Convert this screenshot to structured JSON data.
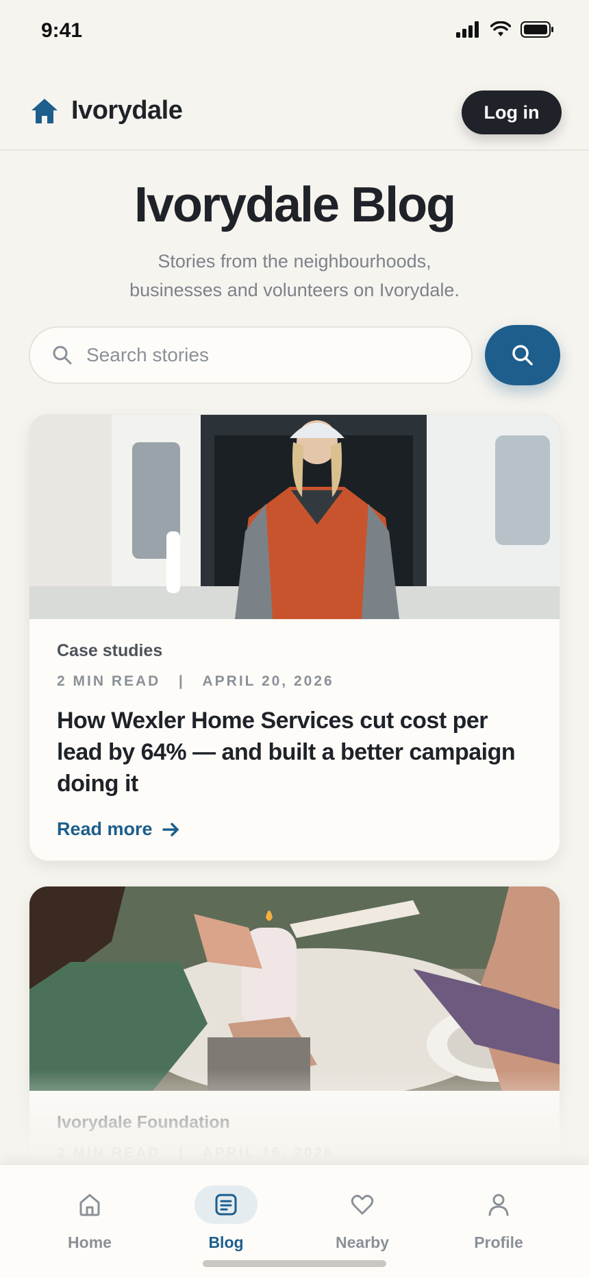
{
  "status_bar": {
    "time": "9:41"
  },
  "header": {
    "brand": "Ivorydale",
    "login_label": "Log in"
  },
  "hero": {
    "title": "Ivorydale Blog",
    "subtitle_line1": "Stories from the neighbourhoods,",
    "subtitle_line2": "businesses and volunteers on Ivorydale."
  },
  "search": {
    "placeholder": "Search stories",
    "value": ""
  },
  "posts": [
    {
      "category": "Case studies",
      "read_time": "2 MIN READ",
      "date": "APRIL 20, 2026",
      "title": "How Wexler Home Services cut cost per lead by 64% — and built a better campaign doing it",
      "read_more": "Read more",
      "image": "worker-in-orange-jacket-at-van"
    },
    {
      "category": "Ivorydale Foundation",
      "read_time": "2 MIN READ",
      "date": "APRIL 16, 2026",
      "image": "hands-lighting-candle-at-dinner-table"
    }
  ],
  "tabs": [
    {
      "label": "Home",
      "icon": "home-icon",
      "active": false
    },
    {
      "label": "Blog",
      "icon": "article-icon",
      "active": true
    },
    {
      "label": "Nearby",
      "icon": "heart-icon",
      "active": false
    },
    {
      "label": "Profile",
      "icon": "person-icon",
      "active": false
    }
  ],
  "colors": {
    "accent": "#1d5e8c",
    "dark": "#1f2228",
    "background": "#f6f4ef"
  }
}
